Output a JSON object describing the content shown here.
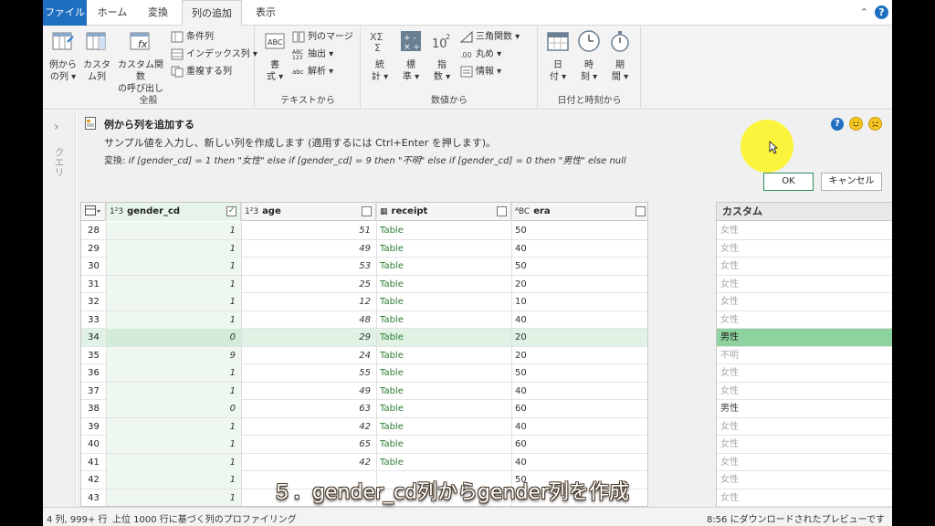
{
  "ribbon": {
    "tabs": [
      {
        "label": "ファイル"
      },
      {
        "label": "ホーム"
      },
      {
        "label": "変換"
      },
      {
        "label": "列の追加"
      },
      {
        "label": "表示"
      }
    ],
    "help": "?",
    "groups": {
      "general": {
        "label": "全般",
        "example_column": "例から\nの列 ▾",
        "custom_column": "カスタ\nム列",
        "invoke_function": "カスタム関数\nの呼び出し",
        "conditional": "条件列",
        "index": "インデックス列 ▾",
        "duplicate": "重複する列"
      },
      "text": {
        "label": "テキストから",
        "format": "書\n式 ▾",
        "merge": "列のマージ",
        "extract": "抽出 ▾",
        "parse": "解析 ▾"
      },
      "number": {
        "label": "数値から",
        "statistics": "統\n計 ▾",
        "standard": "標\n準 ▾",
        "scientific": "指\n数 ▾",
        "trig": "三角関数 ▾",
        "rounding": "丸め ▾",
        "information": "情報 ▾"
      },
      "datetime": {
        "label": "日付と時刻から",
        "date": "日\n付 ▾",
        "time": "時\n刻 ▾",
        "duration": "期\n間 ▾"
      }
    }
  },
  "query_pane": {
    "label": "クエリ",
    "chevron": "›"
  },
  "example": {
    "title": "例から列を追加する",
    "description": "サンプル値を入力し、新しい列を作成します (適用するには Ctrl+Enter を押します)。",
    "transform_prefix": "変換: ",
    "transform_code": "if [gender_cd] = 1 then \"女性\" else if [gender_cd] = 9 then \"不明\" else if [gender_cd] = 0 then \"男性\" else null",
    "ok": "OK",
    "cancel": "キャンセル",
    "help": "?"
  },
  "grid": {
    "columns": [
      {
        "type": "1²3",
        "name": "gender_cd"
      },
      {
        "type": "1²3",
        "name": "age"
      },
      {
        "type": "▦",
        "name": "receipt"
      },
      {
        "type": "ᴬBC",
        "name": "era"
      }
    ],
    "checked_mark": "✓",
    "rows": [
      {
        "idx": "28",
        "gender": "1",
        "age": "51",
        "receipt": "Table",
        "era": "50",
        "custom": "女性"
      },
      {
        "idx": "29",
        "gender": "1",
        "age": "49",
        "receipt": "Table",
        "era": "40",
        "custom": "女性"
      },
      {
        "idx": "30",
        "gender": "1",
        "age": "53",
        "receipt": "Table",
        "era": "50",
        "custom": "女性"
      },
      {
        "idx": "31",
        "gender": "1",
        "age": "25",
        "receipt": "Table",
        "era": "20",
        "custom": "女性"
      },
      {
        "idx": "32",
        "gender": "1",
        "age": "12",
        "receipt": "Table",
        "era": "10",
        "custom": "女性"
      },
      {
        "idx": "33",
        "gender": "1",
        "age": "48",
        "receipt": "Table",
        "era": "40",
        "custom": "女性"
      },
      {
        "idx": "34",
        "gender": "0",
        "age": "29",
        "receipt": "Table",
        "era": "20",
        "custom": "男性"
      },
      {
        "idx": "35",
        "gender": "9",
        "age": "24",
        "receipt": "Table",
        "era": "20",
        "custom": "不明"
      },
      {
        "idx": "36",
        "gender": "1",
        "age": "55",
        "receipt": "Table",
        "era": "50",
        "custom": "女性"
      },
      {
        "idx": "37",
        "gender": "1",
        "age": "49",
        "receipt": "Table",
        "era": "40",
        "custom": "女性"
      },
      {
        "idx": "38",
        "gender": "0",
        "age": "63",
        "receipt": "Table",
        "era": "60",
        "custom": "男性"
      },
      {
        "idx": "39",
        "gender": "1",
        "age": "42",
        "receipt": "Table",
        "era": "40",
        "custom": "女性"
      },
      {
        "idx": "40",
        "gender": "1",
        "age": "65",
        "receipt": "Table",
        "era": "60",
        "custom": "女性"
      },
      {
        "idx": "41",
        "gender": "1",
        "age": "42",
        "receipt": "Table",
        "era": "40",
        "custom": "女性"
      },
      {
        "idx": "42",
        "gender": "1",
        "age": "",
        "receipt": "",
        "era": "50",
        "custom": "女性"
      },
      {
        "idx": "43",
        "gender": "1",
        "age": "",
        "receipt": "",
        "era": "",
        "custom": "女性"
      }
    ]
  },
  "custom_column": {
    "header": "カスタム"
  },
  "status": {
    "columns": "4 列, 999+ 行",
    "profiling": "上位 1000 行に基づく列のプロファイリング",
    "preview": "8:56 にダウンロードされたプレビューです"
  },
  "subtitle": "５．gender_cd列からgender列を作成",
  "colors": {
    "accent": "#1e6fc0",
    "selected": "#8ed2a0",
    "highlight": "#dff2e4",
    "table_link": "#2e7d32"
  }
}
